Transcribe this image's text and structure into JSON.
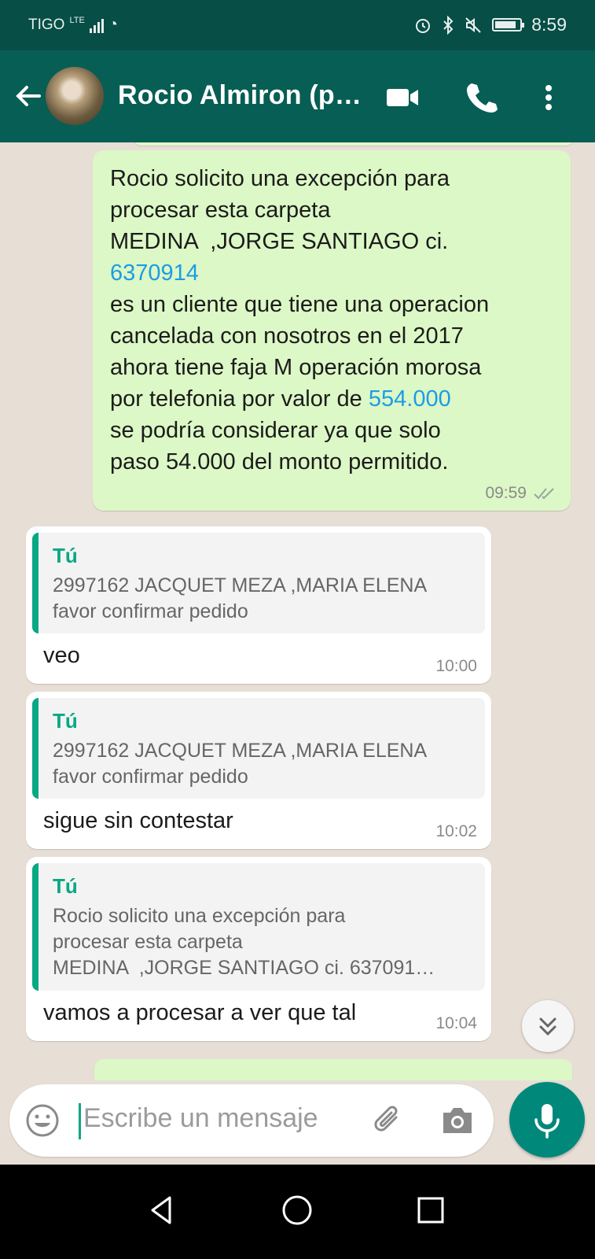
{
  "status_bar": {
    "carrier": "TIGO",
    "network": "LTE",
    "time": "8:59"
  },
  "header": {
    "contact_name": "Rocio Almiron (p…"
  },
  "messages": [
    {
      "direction": "outgoing",
      "text_parts": [
        "Rocio solicito una excepción para\nprocesar esta carpeta\nMEDINA  ,JORGE SANTIAGO ci.\n",
        "6370914",
        "\nes un cliente que tiene una operacion\ncancelada con nosotros en el 2017\nahora tiene faja M operación morosa\npor telefonia por valor de ",
        "554.000",
        "\nse podría considerar ya que solo\npaso 54.000 del monto permitido."
      ],
      "time": "09:59"
    },
    {
      "direction": "incoming",
      "quote_author": "Tú",
      "quote_text": "2997162 JACQUET MEZA ,MARIA ELENA\nfavor confirmar pedido",
      "text": "veo",
      "time": "10:00"
    },
    {
      "direction": "incoming",
      "quote_author": "Tú",
      "quote_text": "2997162 JACQUET MEZA ,MARIA ELENA\nfavor confirmar pedido",
      "text": "sigue sin contestar",
      "time": "10:02"
    },
    {
      "direction": "incoming",
      "quote_author": "Tú",
      "quote_text": "Rocio solicito una excepción para\nprocesar esta carpeta\nMEDINA  ,JORGE SANTIAGO ci. 637091…",
      "text": "vamos a procesar a ver que tal",
      "time": "10:04"
    }
  ],
  "composer": {
    "placeholder": "Escribe un mensaje"
  },
  "colors": {
    "header": "#075e54",
    "status_bar": "#064e46",
    "outgoing_bubble": "#dcf8c6",
    "accent": "#07a884",
    "link": "#1c9ce6"
  },
  "icons": [
    "back-arrow-icon",
    "video-call-icon",
    "phone-icon",
    "more-vert-icon",
    "double-check-icon",
    "chevron-double-down-icon",
    "emoji-icon",
    "attach-icon",
    "camera-icon",
    "mic-icon",
    "nav-back-icon",
    "nav-home-icon",
    "nav-recents-icon"
  ]
}
